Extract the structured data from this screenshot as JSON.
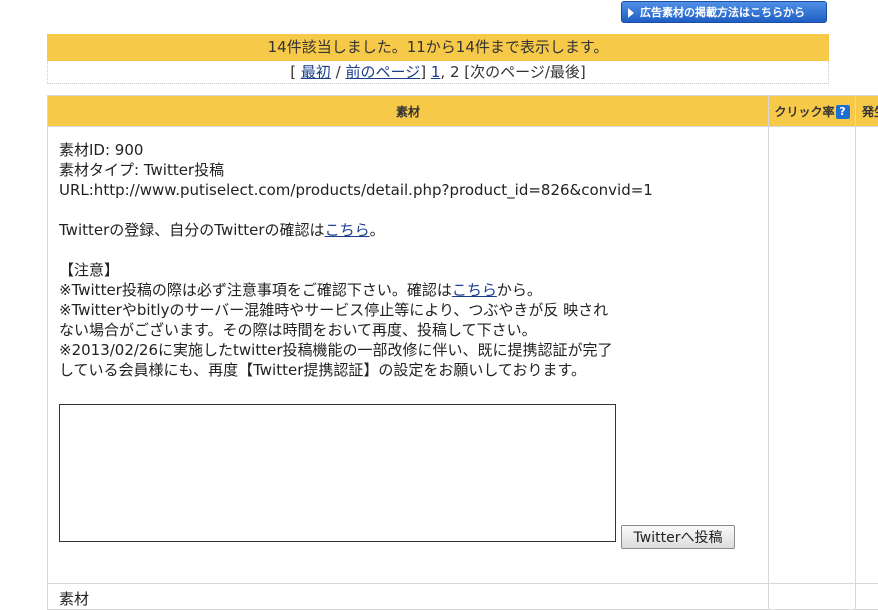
{
  "header": {
    "howto_button_label": "広告素材の掲載方法はこちらから"
  },
  "result": {
    "summary": "14件該当しました。11から14件まで表示します。",
    "pager": {
      "open_bracket": "[",
      "first": "最初",
      "sep1": " / ",
      "prev": "前のページ",
      "close_bracket": "]",
      "page1": "1",
      "comma": ",",
      "current_page": " 2 ",
      "next_last": "[次のページ/最後]"
    }
  },
  "table": {
    "columns": {
      "material": "素材",
      "click_rate": "クリック率",
      "click_rate_help": "?",
      "extra": "発生"
    },
    "row": {
      "material_id": "素材ID: 900",
      "material_type": "素材タイプ: Twitter投稿",
      "url": "URL:http://www.putiselect.com/products/detail.php?product_id=826&convid=1",
      "twitter_reg_text": "Twitterの登録、自分のTwitterの確認は",
      "twitter_reg_link": "こちら",
      "twitter_reg_end": "。",
      "notice_heading": "【注意】",
      "notice1_text": "※Twitter投稿の際は必ず注意事項をご確認下さい。確認は",
      "notice1_link": "こちら",
      "notice1_end": "から。",
      "notice2_line1": "※Twitterやbitlyのサーバー混雑時やサービス停止等により、つぶやきが反 映され",
      "notice2_line2": "ない場合がございます。その際は時間をおいて再度、投稿して下さい。",
      "notice3_line1": "※2013/02/26に実施したtwitter投稿機能の一部改修に伴い、既に提携認証が完了",
      "notice3_line2": "している会員様にも、再度【Twitter提携認証】の設定をお願いしております。",
      "tweet_value": "",
      "tweet_button_label": "Twitterへ投稿"
    },
    "next_row_label": "素材"
  }
}
